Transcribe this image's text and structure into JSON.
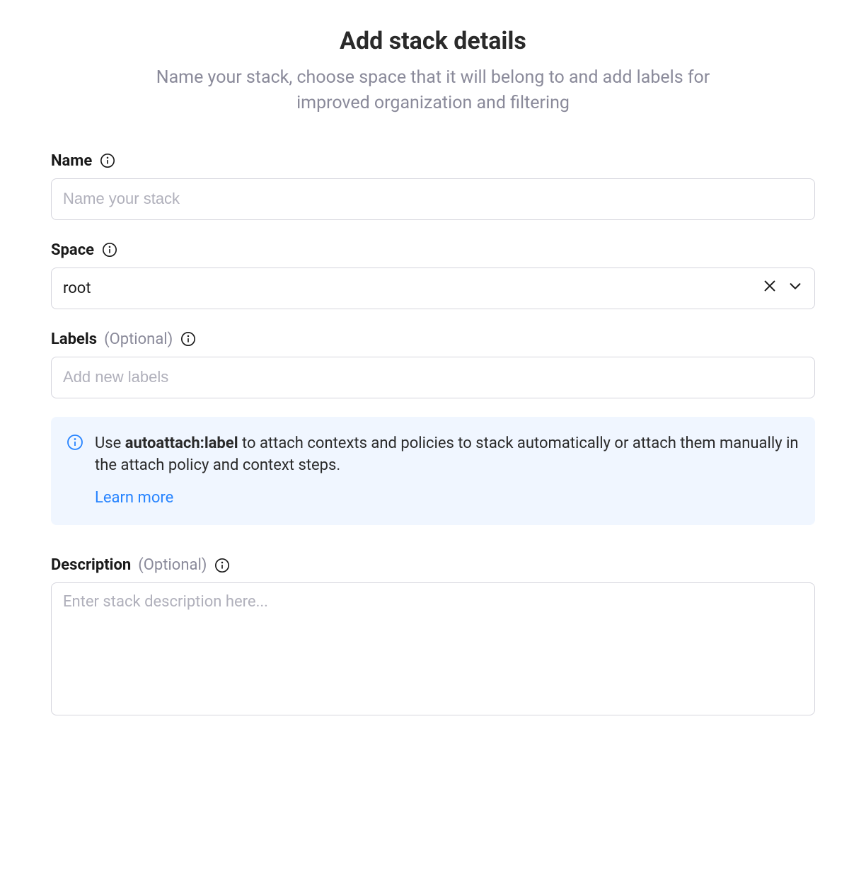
{
  "header": {
    "title": "Add stack details",
    "subtitle": "Name your stack, choose space that it will belong to and add labels for improved organization and filtering"
  },
  "form": {
    "name": {
      "label": "Name",
      "placeholder": "Name your stack",
      "value": ""
    },
    "space": {
      "label": "Space",
      "value": "root"
    },
    "labels": {
      "label": "Labels",
      "optional": "(Optional)",
      "placeholder": "Add new labels",
      "value": ""
    },
    "description": {
      "label": "Description",
      "optional": "(Optional)",
      "placeholder": "Enter stack description here...",
      "value": ""
    }
  },
  "callout": {
    "prefix": "Use ",
    "bold": "autoattach:label",
    "suffix": " to attach contexts and policies to stack automatically or attach them manually in the attach policy and context steps.",
    "link": "Learn more"
  }
}
